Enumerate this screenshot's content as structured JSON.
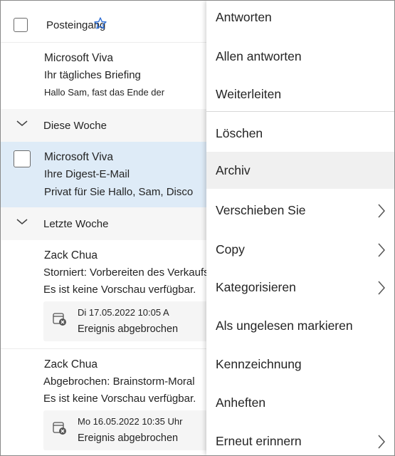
{
  "header": {
    "title": "Posteingang",
    "star_icon": "star-icon"
  },
  "mails": [
    {
      "sender": "Microsoft Viva",
      "subject": "Ihr tägliches Briefing",
      "preview": "Hallo Sam, fast das Ende der"
    },
    {
      "sender": "Microsoft Viva",
      "subject": "Ihre Digest-E-Mail",
      "preview": "Privat für Sie Hallo, Sam, Disco"
    },
    {
      "sender": "Zack Chua",
      "subject": "Storniert: Vorbereiten des Verkaufsberichts",
      "preview": "Es ist keine Vorschau verfügbar.",
      "event_date": "Di 17.05.2022 10:05 A",
      "event_status": "Ereignis abgebrochen"
    },
    {
      "sender": "Zack Chua",
      "subject": "Abgebrochen: Brainstorm-Moral",
      "preview": "Es ist keine Vorschau verfügbar.",
      "event_date": "Mo 16.05.2022 10:35 Uhr",
      "event_status": "Ereignis abgebrochen"
    }
  ],
  "groups": [
    {
      "label": "Diese Woche"
    },
    {
      "label": "Letzte Woche"
    }
  ],
  "menu": {
    "items": [
      {
        "label": "Antworten"
      },
      {
        "label": "Allen antworten"
      },
      {
        "label": "Weiterleiten"
      },
      {
        "label": "Löschen"
      },
      {
        "label": "Archiv"
      },
      {
        "label": "Verschieben Sie"
      },
      {
        "label": "Copy"
      },
      {
        "label": "Kategorisieren"
      },
      {
        "label": "Als ungelesen markieren"
      },
      {
        "label": "Kennzeichnung"
      },
      {
        "label": "Anheften"
      },
      {
        "label": "Erneut erinnern"
      }
    ]
  },
  "colors": {
    "selected_row": "#deebf7",
    "group_background": "#f6f6f6",
    "menu_hover": "#f0f0f0",
    "accent": "#2f6fd6"
  }
}
